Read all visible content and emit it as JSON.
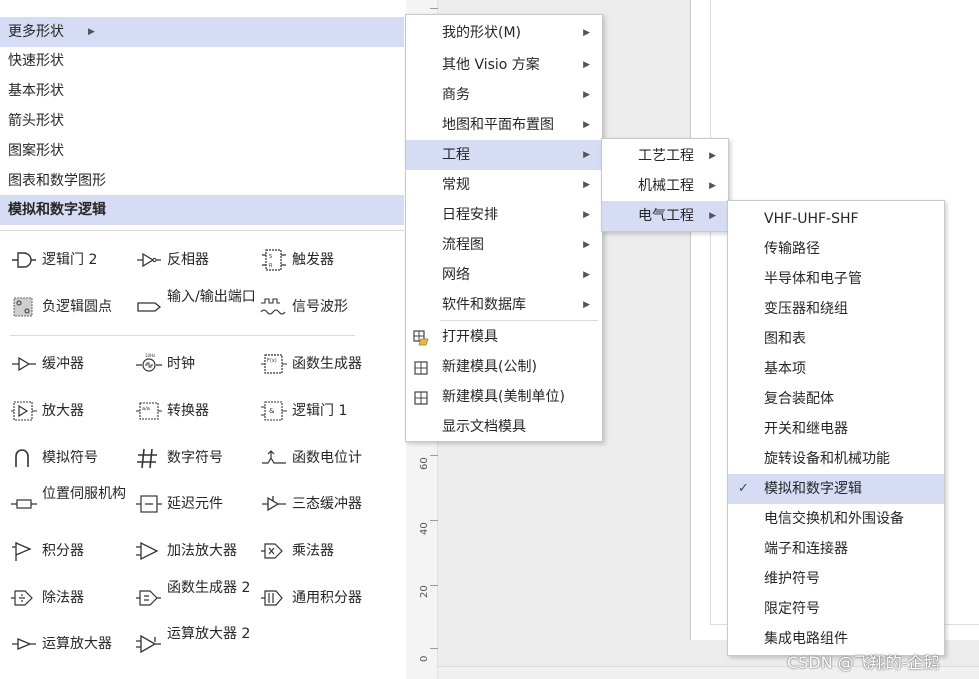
{
  "categories": [
    {
      "label": "更多形状",
      "highlight": true,
      "bold": false,
      "arrow": "▶"
    },
    {
      "label": "快速形状",
      "highlight": false,
      "bold": false
    },
    {
      "label": "基本形状",
      "highlight": false,
      "bold": false
    },
    {
      "label": "箭头形状",
      "highlight": false,
      "bold": false
    },
    {
      "label": "图案形状",
      "highlight": false,
      "bold": false
    },
    {
      "label": "图表和数学图形",
      "highlight": false,
      "bold": false
    },
    {
      "label": "模拟和数字逻辑",
      "highlight": true,
      "bold": true
    }
  ],
  "shapes": [
    {
      "label": "逻辑门 2",
      "icon": "logic-gate-icon"
    },
    {
      "label": "反相器",
      "icon": "inverter-icon"
    },
    {
      "label": "触发器",
      "icon": "flip-flop-icon"
    },
    {
      "label": "负逻辑圆点",
      "icon": "negative-logic-dot-icon"
    },
    {
      "label": "输入/输出端口",
      "icon": "io-port-icon"
    },
    {
      "label": "信号波形",
      "icon": "signal-waveform-icon"
    },
    {
      "label": "缓冲器",
      "icon": "buffer-icon"
    },
    {
      "label": "时钟",
      "icon": "clock-icon"
    },
    {
      "label": "函数生成器",
      "icon": "function-generator-icon"
    },
    {
      "label": "放大器",
      "icon": "amplifier-icon"
    },
    {
      "label": "转换器",
      "icon": "converter-icon"
    },
    {
      "label": "逻辑门 1",
      "icon": "logic-gate-1-icon"
    },
    {
      "label": "模拟符号",
      "icon": "analog-symbol-icon"
    },
    {
      "label": "数字符号",
      "icon": "digital-symbol-icon"
    },
    {
      "label": "函数电位计",
      "icon": "potentiometer-icon"
    },
    {
      "label": "位置伺服机构",
      "icon": "servo-icon"
    },
    {
      "label": "延迟元件",
      "icon": "delay-element-icon"
    },
    {
      "label": "三态缓冲器",
      "icon": "tristate-buffer-icon"
    },
    {
      "label": "积分器",
      "icon": "integrator-icon"
    },
    {
      "label": "加法放大器",
      "icon": "summing-amplifier-icon"
    },
    {
      "label": "乘法器",
      "icon": "multiplier-icon"
    },
    {
      "label": "除法器",
      "icon": "divider-icon"
    },
    {
      "label": "函数生成器 2",
      "icon": "function-generator-2-icon"
    },
    {
      "label": "通用积分器",
      "icon": "general-integrator-icon"
    },
    {
      "label": "运算放大器",
      "icon": "op-amp-icon"
    },
    {
      "label": "运算放大器 2",
      "icon": "op-amp-2-icon"
    }
  ],
  "ruler": {
    "numbers": [
      "60",
      "40",
      "20",
      "0"
    ]
  },
  "menu1": {
    "items": [
      {
        "label": "我的形状(M)",
        "arrow": "▶"
      },
      {
        "label": "其他 Visio 方案",
        "arrow": "▶"
      },
      {
        "label": "商务",
        "arrow": "▶"
      },
      {
        "label": "地图和平面布置图",
        "arrow": "▶"
      },
      {
        "label": "工程",
        "arrow": "▶",
        "highlight": true
      },
      {
        "label": "常规",
        "arrow": "▶"
      },
      {
        "label": "日程安排",
        "arrow": "▶"
      },
      {
        "label": "流程图",
        "arrow": "▶"
      },
      {
        "label": "网络",
        "arrow": "▶"
      },
      {
        "label": "软件和数据库",
        "arrow": "▶"
      }
    ],
    "actions": [
      {
        "label": "打开模具",
        "icon": "open-stencil-icon"
      },
      {
        "label": "新建模具(公制)",
        "icon": "new-stencil-icon"
      },
      {
        "label": "新建模具(美制单位)",
        "icon": "new-stencil-icon"
      },
      {
        "label": "显示文档模具",
        "icon": ""
      }
    ]
  },
  "menu2": {
    "items": [
      {
        "label": "工艺工程",
        "arrow": "▶"
      },
      {
        "label": "机械工程",
        "arrow": "▶"
      },
      {
        "label": "电气工程",
        "arrow": "▶",
        "highlight": true
      }
    ]
  },
  "menu3": {
    "items": [
      {
        "label": "VHF-UHF-SHF"
      },
      {
        "label": "传输路径"
      },
      {
        "label": "半导体和电子管"
      },
      {
        "label": "变压器和绕组"
      },
      {
        "label": "图和表"
      },
      {
        "label": "基本项"
      },
      {
        "label": "复合装配体"
      },
      {
        "label": "开关和继电器"
      },
      {
        "label": "旋转设备和机械功能"
      },
      {
        "label": "模拟和数字逻辑",
        "checked": true,
        "check": "✓"
      },
      {
        "label": "电信交换机和外围设备"
      },
      {
        "label": "端子和连接器"
      },
      {
        "label": "维护符号"
      },
      {
        "label": "限定符号"
      },
      {
        "label": "集成电路组件"
      }
    ]
  },
  "watermark": "CSDN @飞翔的-企鹅",
  "colors": {
    "highlight": "#d5dcf3",
    "menu_border": "#c8c8c8",
    "text": "#262626"
  }
}
